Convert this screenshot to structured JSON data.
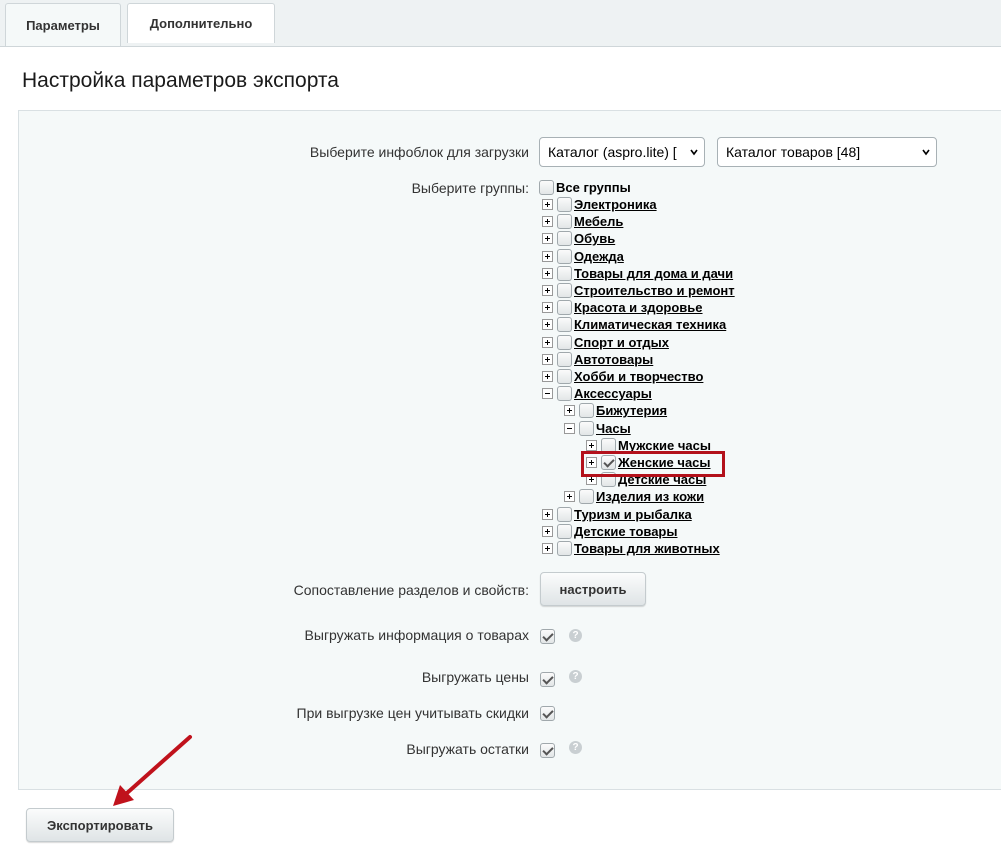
{
  "tabs": [
    {
      "label": "Параметры",
      "active": true
    },
    {
      "label": "Дополнительно",
      "active": false
    }
  ],
  "page_title": "Настройка параметров экспорта",
  "iblock": {
    "label": "Выберите инфоблок для загрузки",
    "type_select": "Каталог (aspro.lite) [",
    "catalog_select": "Каталог товаров [48]"
  },
  "groups": {
    "label": "Выберите группы:",
    "all_label": "Все группы",
    "items": [
      {
        "label": "Электроника",
        "level": 0,
        "expanded": false,
        "checked": false
      },
      {
        "label": "Мебель",
        "level": 0,
        "expanded": false,
        "checked": false
      },
      {
        "label": "Обувь",
        "level": 0,
        "expanded": false,
        "checked": false
      },
      {
        "label": "Одежда",
        "level": 0,
        "expanded": false,
        "checked": false
      },
      {
        "label": "Товары для дома и дачи",
        "level": 0,
        "expanded": false,
        "checked": false
      },
      {
        "label": "Строительство и ремонт",
        "level": 0,
        "expanded": false,
        "checked": false
      },
      {
        "label": "Красота и здоровье",
        "level": 0,
        "expanded": false,
        "checked": false
      },
      {
        "label": "Климатическая техника",
        "level": 0,
        "expanded": false,
        "checked": false
      },
      {
        "label": "Спорт и отдых",
        "level": 0,
        "expanded": false,
        "checked": false
      },
      {
        "label": "Автотовары",
        "level": 0,
        "expanded": false,
        "checked": false
      },
      {
        "label": "Хобби и творчество",
        "level": 0,
        "expanded": false,
        "checked": false
      },
      {
        "label": "Аксессуары",
        "level": 0,
        "expanded": true,
        "checked": false
      },
      {
        "label": "Бижутерия",
        "level": 1,
        "expanded": false,
        "checked": false
      },
      {
        "label": "Часы",
        "level": 1,
        "expanded": true,
        "checked": false
      },
      {
        "label": "Мужские часы",
        "level": 2,
        "expanded": false,
        "checked": false
      },
      {
        "label": "Женские часы",
        "level": 2,
        "expanded": false,
        "checked": true
      },
      {
        "label": "Детские часы",
        "level": 2,
        "expanded": false,
        "checked": false
      },
      {
        "label": "Изделия из кожи",
        "level": 1,
        "expanded": false,
        "checked": false
      },
      {
        "label": "Туризм и рыбалка",
        "level": 0,
        "expanded": false,
        "checked": false
      },
      {
        "label": "Детские товары",
        "level": 0,
        "expanded": false,
        "checked": false
      },
      {
        "label": "Товары для животных",
        "level": 0,
        "expanded": false,
        "checked": false
      }
    ]
  },
  "mapping": {
    "label": "Сопоставление разделов и свойств:",
    "button": "настроить"
  },
  "options": [
    {
      "label": "Выгружать информация о товарах",
      "checked": true,
      "help": true
    },
    {
      "label": "Выгружать цены",
      "checked": true,
      "help": true
    },
    {
      "label": "При выгрузке цен учитывать скидки",
      "checked": true,
      "help": false
    },
    {
      "label": "Выгружать остатки",
      "checked": true,
      "help": true
    }
  ],
  "help_glyph": "?",
  "export_button": "Экспортировать",
  "colors": {
    "highlight": "#b3111b",
    "annotation_arrow": "#c0121c",
    "panel_bg": "#f5f9f9"
  }
}
